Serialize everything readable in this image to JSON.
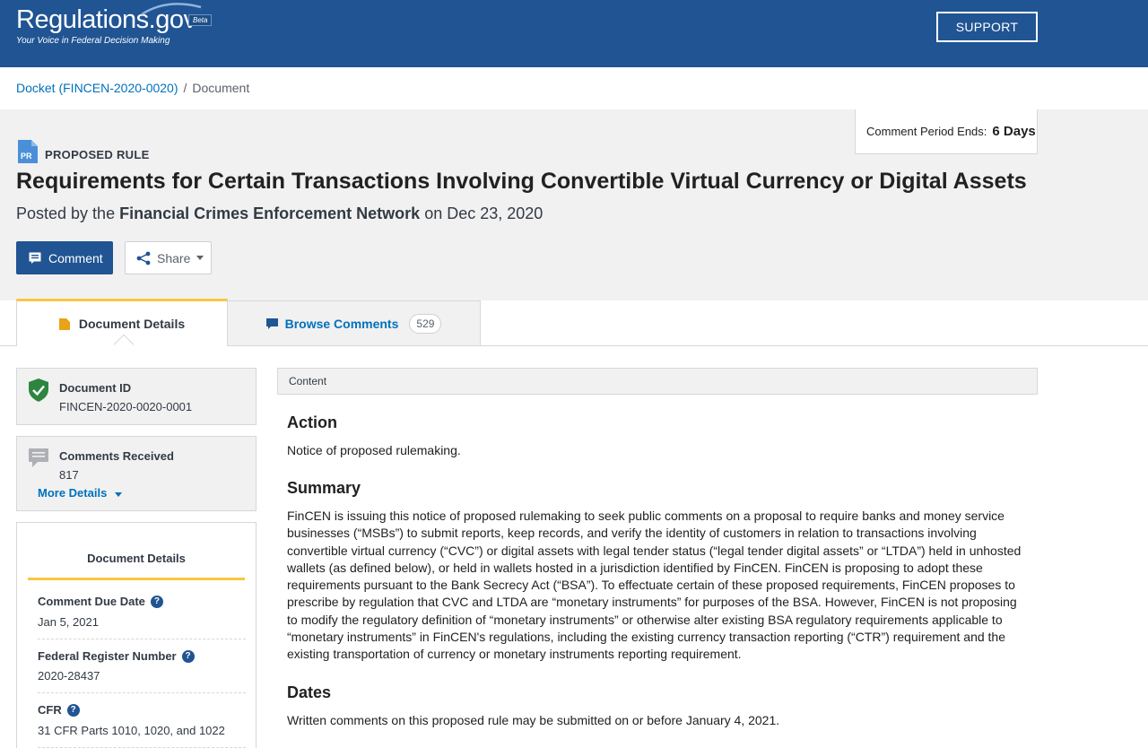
{
  "header": {
    "logo_text": "Regulations.gov",
    "beta": "Beta",
    "tagline": "Your Voice in Federal Decision Making",
    "support_label": "SUPPORT"
  },
  "breadcrumb": {
    "docket": "Docket (FINCEN-2020-0020)",
    "sep": "/",
    "current": "Document"
  },
  "hero": {
    "period_label": "Comment Period Ends:",
    "period_value": "6 Days",
    "type_icon_text": "PR",
    "doc_type": "PROPOSED RULE",
    "title": "Requirements for Certain Transactions Involving Convertible Virtual Currency or Digital Assets",
    "posted_prefix": "Posted by the",
    "agency": "Financial Crimes Enforcement Network",
    "posted_on": "on Dec 23, 2020",
    "comment_label": "Comment",
    "share_label": "Share"
  },
  "tabs": {
    "details": "Document Details",
    "browse": "Browse Comments",
    "browse_count": "529"
  },
  "sidebar": {
    "doc_id_label": "Document ID",
    "doc_id": "FINCEN-2020-0020-0001",
    "received_label": "Comments Received",
    "received": "817",
    "more_details": "More Details",
    "details_title": "Document Details",
    "meta": [
      {
        "label": "Comment Due Date",
        "value": "Jan 5, 2021"
      },
      {
        "label": "Federal Register Number",
        "value": "2020-28437"
      },
      {
        "label": "CFR",
        "value": "31 CFR Parts 1010, 1020, and 1022"
      }
    ]
  },
  "content": {
    "header": "Content",
    "action_heading": "Action",
    "action_text": "Notice of proposed rulemaking.",
    "summary_heading": "Summary",
    "summary_text": "FinCEN is issuing this notice of proposed rulemaking to seek public comments on a proposal to require banks and money service businesses (“MSBs”) to submit reports, keep records, and verify the identity of customers in relation to transactions involving convertible virtual currency (“CVC”) or digital assets with legal tender status (“legal tender digital assets” or “LTDA”) held in unhosted wallets (as defined below), or held in wallets hosted in a jurisdiction identified by FinCEN. FinCEN is proposing to adopt these requirements pursuant to the Bank Secrecy Act (“BSA”). To effectuate certain of these proposed requirements, FinCEN proposes to prescribe by regulation that CVC and LTDA are “monetary instruments” for purposes of the BSA. However, FinCEN is not proposing to modify the regulatory definition of “monetary instruments” or otherwise alter existing BSA regulatory requirements applicable to “monetary instruments” in FinCEN's regulations, including the existing currency transaction reporting (“CTR”) requirement and the existing transportation of currency or monetary instruments reporting requirement.",
    "dates_heading": "Dates",
    "dates_text": "Written comments on this proposed rule may be submitted on or before January 4, 2021."
  },
  "colors": {
    "brand": "#205493",
    "link": "#0071bc",
    "accent": "#f9c642",
    "panel": "#f1f1f1"
  }
}
